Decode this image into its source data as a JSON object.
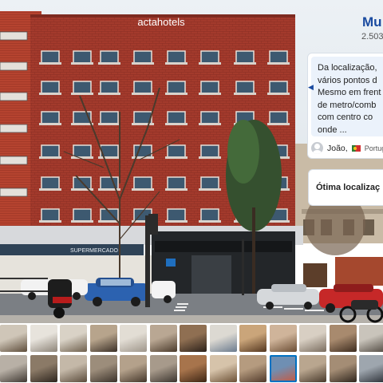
{
  "hotel_sign": "actahotels",
  "store_sign": "SUPERMERCADO",
  "score": {
    "title": "Mu",
    "count": "2.503"
  },
  "review": {
    "text": "Da localização,\nvários pontos d\nMesmo em frent\nde metro/comb\ncom centro co\nonde ...",
    "prev_icon": "chevron-left-icon",
    "reviewer_name": "João,",
    "country": "Portug"
  },
  "highlight": {
    "label": "Ótima localizaç"
  },
  "gallery": {
    "rows": 2,
    "columns": 13,
    "selected_index": 22,
    "colors": [
      [
        "#cfc6b8",
        "#5d4c3a"
      ],
      [
        "#e7e3dc",
        "#8d8478"
      ],
      [
        "#d9d2c6",
        "#6e5f4c"
      ],
      [
        "#b7a48c",
        "#3a2f26"
      ],
      [
        "#e2ddd4",
        "#9e958a"
      ],
      [
        "#b9a793",
        "#4a3a2b"
      ],
      [
        "#8f6f52",
        "#2b211a"
      ],
      [
        "#dcd9d2",
        "#6b7b8e"
      ],
      [
        "#caa57a",
        "#53361f"
      ],
      [
        "#cfb49a",
        "#6b4d34"
      ],
      [
        "#d8cfc3",
        "#7a6d5f"
      ],
      [
        "#a88a6e",
        "#3d2c1f"
      ],
      [
        "#c9c4bb",
        "#514a42"
      ],
      [
        "#b8b0a6",
        "#3f3832"
      ],
      [
        "#8b7a67",
        "#2d251e"
      ],
      [
        "#c4b8a8",
        "#5a4b3b"
      ],
      [
        "#9c8d7b",
        "#3b322a"
      ],
      [
        "#b4a18b",
        "#44362a"
      ],
      [
        "#a79a8b",
        "#3b342e"
      ],
      [
        "#a7744c",
        "#3d2614"
      ],
      [
        "#d6c3aa",
        "#6b5035"
      ],
      [
        "#b59b7f",
        "#50392a"
      ],
      [
        "#6f8fb3",
        "#c9573d"
      ],
      [
        "#b9a68f",
        "#48392b"
      ],
      [
        "#a48d75",
        "#2f251d"
      ],
      [
        "#9ea6ae",
        "#2c3037"
      ]
    ]
  }
}
